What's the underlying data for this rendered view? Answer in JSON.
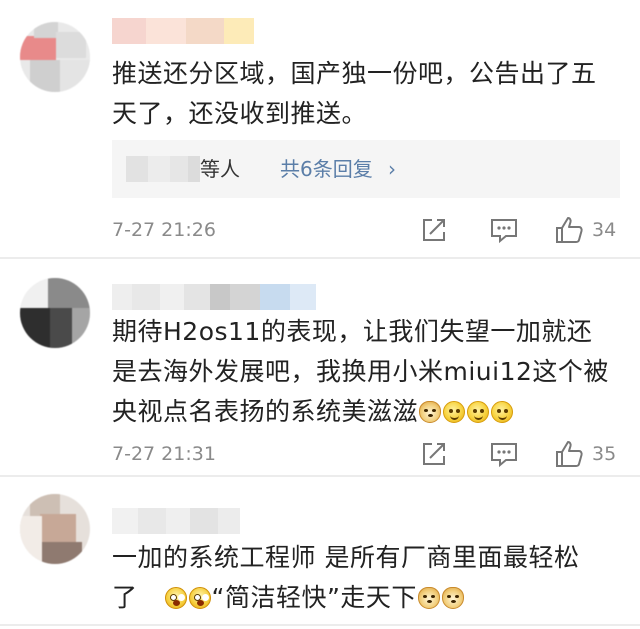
{
  "colors": {
    "link": "#5b7ea8",
    "meta_text": "#8a8a8a",
    "body_text": "#222222",
    "reply_box_bg": "#f5f5f5",
    "divider": "#ececec"
  },
  "comments": [
    {
      "text_lines": [
        "推送还分区域，国产独一份吧，公告出了五",
        "天了，还没收到推送。"
      ],
      "replies": {
        "names_suffix": "等人",
        "link_label": "共6条回复",
        "chevron": "›"
      },
      "time": "7-27 21:26",
      "likes": "34",
      "icons": [
        "share-icon",
        "reply-icon",
        "like-icon"
      ]
    },
    {
      "text_lines": [
        "期待H2os11的表现，让我们失望一加就还",
        "是去海外发展吧，我换用小米miui12这个被",
        "央视点名表扬的系统美滋滋"
      ],
      "emojis_after_last_line": [
        "doge",
        "smile",
        "smile",
        "smile"
      ],
      "time": "7-27 21:31",
      "likes": "35",
      "icons": [
        "share-icon",
        "reply-icon",
        "like-icon"
      ]
    },
    {
      "text_lines": [
        "一加的系统工程师 是所有厂商里面最轻松"
      ],
      "line2_prefix": "了",
      "line2_emojis_a": [
        "scared",
        "scared"
      ],
      "line2_text": "“简洁轻快”走天下",
      "line2_emojis_b": [
        "doge",
        "doge"
      ]
    }
  ]
}
